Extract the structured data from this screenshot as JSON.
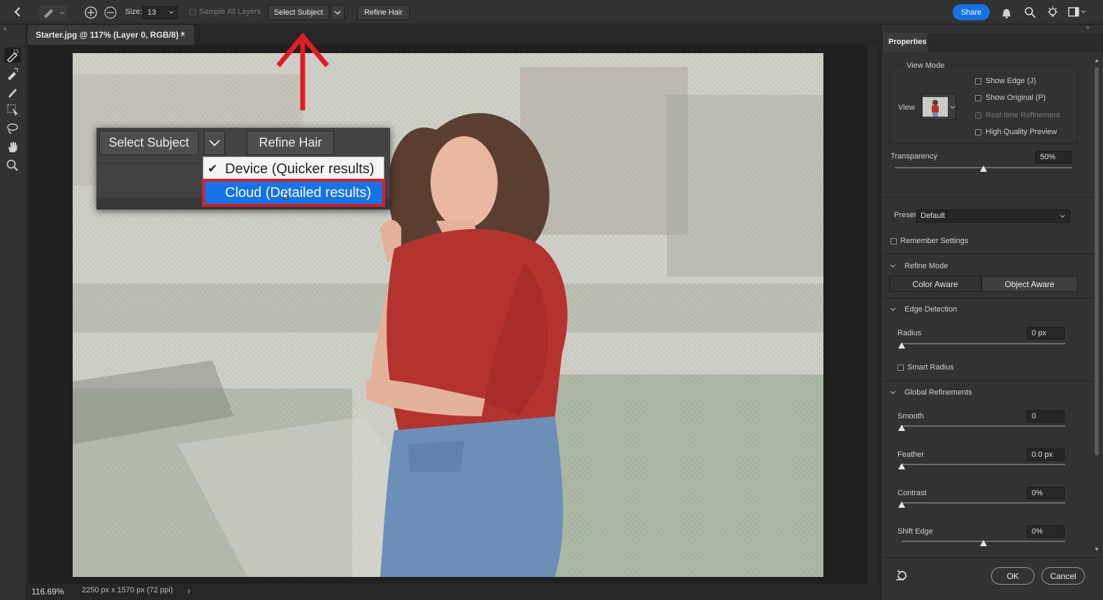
{
  "toolbar": {
    "size_label": "Size:",
    "size_value": "13",
    "sample_all_layers": "Sample All Layers",
    "select_subject": "Select Subject",
    "refine_hair": "Refine Hair",
    "share": "Share",
    "share_color": "#1473e6"
  },
  "tab": {
    "title": "Starter.jpg @ 117% (Layer 0, RGB/8) *",
    "close": "×"
  },
  "callout": {
    "select_subject": "Select Subject",
    "refine_hair": "Refine Hair",
    "menu": [
      {
        "label": "Device (Quicker results)",
        "checked": true,
        "check": "✔"
      },
      {
        "label": "Cloud (Detailed results)",
        "checked": false
      }
    ],
    "highlight_color": "#e01b24"
  },
  "status": {
    "zoom": "116.69%",
    "doc_size": "2250 px x 1570 px (72 ppi)",
    "arrow": "›"
  },
  "properties": {
    "tab": "Properties",
    "view_mode": "View Mode",
    "view_label": "View",
    "show_edge": "Show Edge (J)",
    "show_original": "Show Original (P)",
    "realtime_refinement": "Real-time Refinement",
    "high_quality_preview": "High Quality Preview",
    "transparency_label": "Transparency",
    "transparency_value": "50%",
    "transparency_level": 0.5,
    "preset_label": "Preset",
    "preset_value": "Default",
    "remember_settings": "Remember Settings",
    "refine_mode": "Refine Mode",
    "color_aware": "Color Aware",
    "object_aware": "Object Aware",
    "edge_detection": "Edge Detection",
    "radius_label": "Radius",
    "radius_value": "0 px",
    "smart_radius": "Smart Radius",
    "global_refinements": "Global Refinements",
    "smooth_label": "Smooth",
    "smooth_value": "0",
    "feather_label": "Feather",
    "feather_value": "0.0 px",
    "contrast_label": "Contrast",
    "contrast_value": "0%",
    "shift_edge_label": "Shift Edge",
    "shift_edge_value": "0%",
    "ok": "OK",
    "cancel": "Cancel"
  }
}
